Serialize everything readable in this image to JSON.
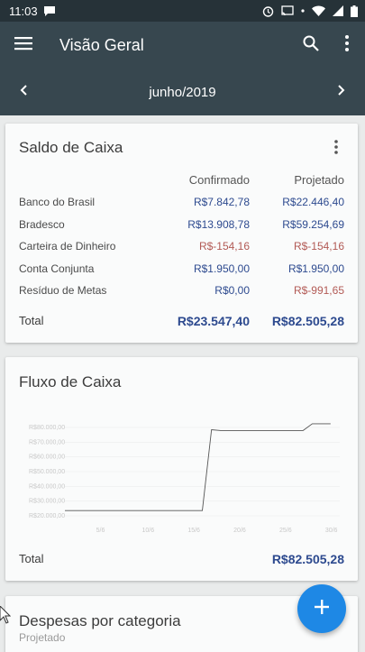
{
  "status_bar": {
    "time": "11:03",
    "icons": [
      "chat-icon",
      "alarm-icon",
      "cast-icon",
      "dot-icon",
      "wifi-icon",
      "signal-icon",
      "battery-icon"
    ]
  },
  "app_bar": {
    "title": "Visão Geral",
    "icons": [
      "menu-icon",
      "search-icon",
      "more-vert-icon"
    ]
  },
  "month_nav": {
    "label": "junho/2019",
    "icons": [
      "chevron-left-icon",
      "chevron-right-icon"
    ]
  },
  "colors": {
    "positive": "#2d4a8f",
    "negative": "#b25a55",
    "appbar": "#37474f",
    "statusbar": "#263238",
    "fab": "#1e88e5"
  },
  "saldo": {
    "title": "Saldo de Caixa",
    "col_confirmed": "Confirmado",
    "col_projected": "Projetado",
    "rows": [
      {
        "name": "Banco do Brasil",
        "confirmed": "R$7.842,78",
        "projected": "R$22.446,40"
      },
      {
        "name": "Bradesco",
        "confirmed": "R$13.908,78",
        "projected": "R$59.254,69"
      },
      {
        "name": "Carteira de Dinheiro",
        "confirmed": "R$-154,16",
        "projected": "R$-154,16"
      },
      {
        "name": "Conta Conjunta",
        "confirmed": "R$1.950,00",
        "projected": "R$1.950,00"
      },
      {
        "name": "Resíduo de Metas",
        "confirmed": "R$0,00",
        "projected": "R$-991,65"
      }
    ],
    "total_label": "Total",
    "total_confirmed": "R$23.547,40",
    "total_projected": "R$82.505,28"
  },
  "fluxo": {
    "title": "Fluxo de Caixa",
    "total_label": "Total",
    "total_value": "R$82.505,28"
  },
  "chart_data": {
    "type": "line",
    "x_ticks": [
      "5/6",
      "10/6",
      "15/6",
      "20/6",
      "25/6",
      "30/6"
    ],
    "y_ticks": [
      "R$20.000,00",
      "R$30.000,00",
      "R$40.000,00",
      "R$50.000,00",
      "R$60.000,00",
      "R$70.000,00",
      "R$80.000,00"
    ],
    "ylim": [
      20000,
      80000
    ],
    "x": [
      1,
      16,
      17,
      18,
      27,
      28,
      30
    ],
    "values": [
      23547,
      23547,
      78500,
      77900,
      77900,
      82505,
      82505
    ]
  },
  "despesas": {
    "title": "Despesas por categoria",
    "subtitle": "Projetado"
  }
}
